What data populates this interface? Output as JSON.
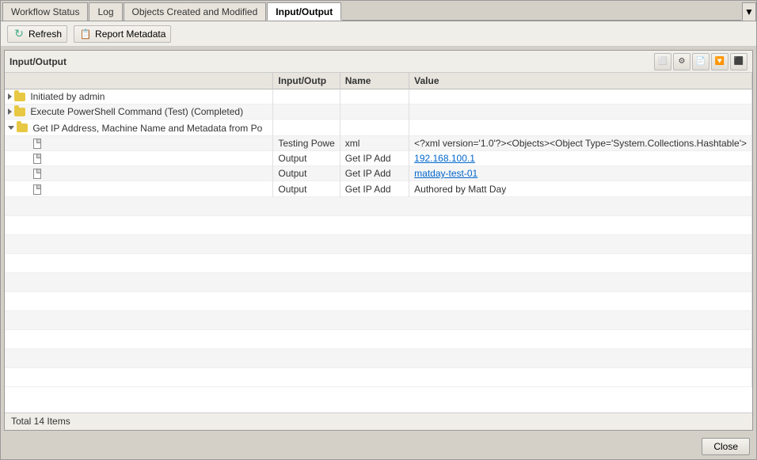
{
  "tabs": [
    {
      "id": "workflow-status",
      "label": "Workflow Status",
      "active": false
    },
    {
      "id": "log",
      "label": "Log",
      "active": false
    },
    {
      "id": "objects-created",
      "label": "Objects Created and Modified",
      "active": false
    },
    {
      "id": "input-output",
      "label": "Input/Output",
      "active": true
    }
  ],
  "toolbar": {
    "refresh_label": "Refresh",
    "report_metadata_label": "Report Metadata"
  },
  "inner_toolbar": {
    "title": "Input/Output"
  },
  "table": {
    "headers": [
      {
        "id": "name",
        "label": ""
      },
      {
        "id": "io",
        "label": "Input/Outp"
      },
      {
        "id": "namedata",
        "label": "Name"
      },
      {
        "id": "value",
        "label": "Value"
      }
    ],
    "rows": [
      {
        "indent": 0,
        "type": "folder-expand",
        "arrow": "right",
        "name": "Initiated by admin",
        "io": "",
        "namedata": "",
        "value": ""
      },
      {
        "indent": 0,
        "type": "folder-expand",
        "arrow": "right",
        "name": "Execute PowerShell Command (Test) (Completed)",
        "io": "",
        "namedata": "",
        "value": ""
      },
      {
        "indent": 0,
        "type": "folder-collapse",
        "arrow": "down",
        "name": "Get IP Address, Machine Name and Metadata from Po",
        "io": "",
        "namedata": "",
        "value": ""
      },
      {
        "indent": 1,
        "type": "doc",
        "arrow": "",
        "name": "",
        "io": "Testing Powe",
        "namedata": "xml",
        "value": "<?xml version='1.0'?><Objects><Object Type='System.Collections.Hashtable'>"
      },
      {
        "indent": 1,
        "type": "doc",
        "arrow": "",
        "name": "",
        "io": "Output",
        "namedata": "Get IP Add",
        "value": "192.168.100.1",
        "value_link": true
      },
      {
        "indent": 1,
        "type": "doc",
        "arrow": "",
        "name": "",
        "io": "Output",
        "namedata": "Get IP Add",
        "value": "matday-test-01",
        "value_link": true
      },
      {
        "indent": 1,
        "type": "doc",
        "arrow": "",
        "name": "",
        "io": "Output",
        "namedata": "Get IP Add",
        "value": "Authored by Matt Day"
      }
    ]
  },
  "status_bar": {
    "text": "Total 14 Items"
  },
  "footer": {
    "close_label": "Close"
  }
}
